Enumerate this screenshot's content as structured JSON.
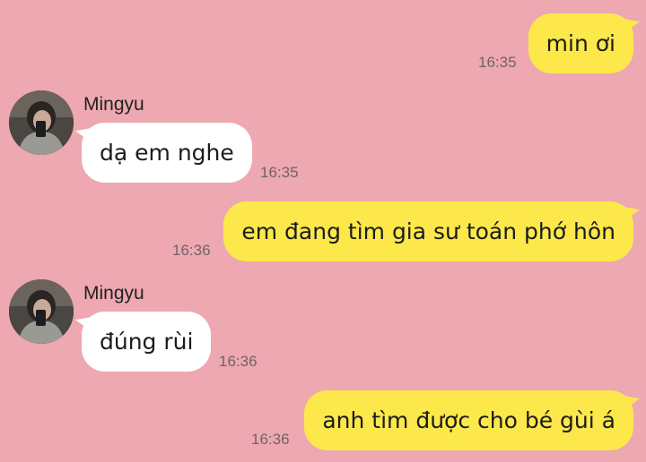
{
  "conversation": {
    "messages": [
      {
        "direction": "outgoing",
        "text": "min ơi",
        "time": "16:35"
      },
      {
        "direction": "incoming",
        "sender": "Mingyu",
        "text": "dạ em nghe",
        "time": "16:35"
      },
      {
        "direction": "outgoing",
        "text": "em đang tìm gia sư toán phớ hôn",
        "time": "16:36"
      },
      {
        "direction": "incoming",
        "sender": "Mingyu",
        "text": "đúng rùi",
        "time": "16:36"
      },
      {
        "direction": "outgoing",
        "text": "anh tìm được cho bé gùi á",
        "time": "16:36"
      }
    ]
  },
  "colors": {
    "background": "#eda8b1",
    "outgoing_bubble": "#fde84b",
    "incoming_bubble": "#ffffff"
  }
}
